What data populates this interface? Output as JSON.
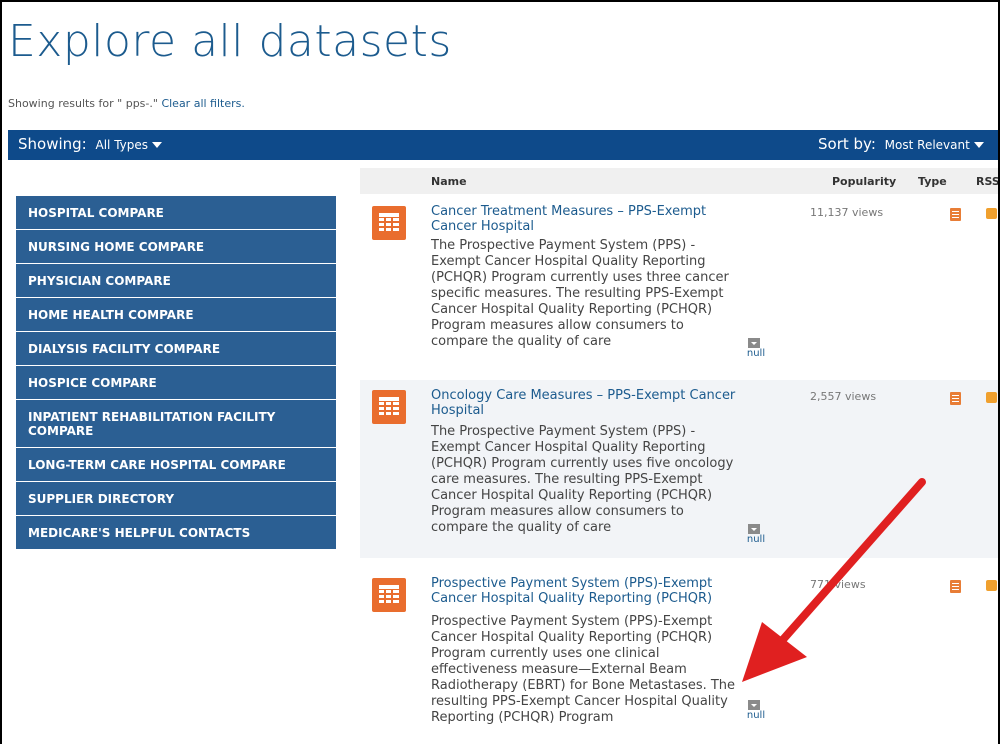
{
  "page": {
    "title": "Explore all datasets"
  },
  "filters": {
    "showing_prefix": "Showing results for \" pps-.\"",
    "clear_link": "Clear all filters."
  },
  "toolbar": {
    "showing_label": "Showing:",
    "showing_value": "All Types",
    "sort_label": "Sort by:",
    "sort_value": "Most Relevant"
  },
  "table": {
    "headers": {
      "name": "Name",
      "popularity": "Popularity",
      "type": "Type",
      "rss": "RSS"
    }
  },
  "sidebar": {
    "items": [
      {
        "label": "HOSPITAL COMPARE"
      },
      {
        "label": "NURSING HOME COMPARE"
      },
      {
        "label": "PHYSICIAN COMPARE"
      },
      {
        "label": "HOME HEALTH COMPARE"
      },
      {
        "label": "DIALYSIS FACILITY COMPARE"
      },
      {
        "label": "HOSPICE COMPARE"
      },
      {
        "label": "INPATIENT REHABILITATION FACILITY COMPARE"
      },
      {
        "label": "LONG-TERM CARE HOSPITAL COMPARE"
      },
      {
        "label": "SUPPLIER DIRECTORY"
      },
      {
        "label": "MEDICARE'S HELPFUL CONTACTS"
      }
    ]
  },
  "results": [
    {
      "title": "Cancer Treatment Measures – PPS-Exempt Cancer Hospital",
      "description": "The Prospective Payment System (PPS) -Exempt Cancer Hospital Quality Reporting (PCHQR) Program currently uses three cancer specific measures. The resulting PPS-Exempt Cancer Hospital Quality Reporting (PCHQR) Program measures allow consumers to compare the quality of care",
      "views": "11,137 views",
      "null_label": "null"
    },
    {
      "title": "Oncology Care Measures – PPS-Exempt Cancer Hospital",
      "description": "The Prospective Payment System (PPS) -Exempt Cancer Hospital Quality Reporting (PCHQR) Program currently uses five oncology care measures. The resulting PPS-Exempt Cancer Hospital Quality Reporting (PCHQR) Program measures allow consumers to compare the quality of care",
      "views": "2,557 views",
      "null_label": "null"
    },
    {
      "title": "Prospective Payment System (PPS)-Exempt Cancer Hospital Quality Reporting (PCHQR)",
      "description": "Prospective Payment System (PPS)-Exempt Cancer Hospital Quality Reporting (PCHQR) Program currently uses one clinical effectiveness measure—External Beam Radiotherapy (EBRT) for Bone Metastases. The resulting PPS-Exempt Cancer Hospital Quality Reporting (PCHQR) Program",
      "views": "771 views",
      "null_label": "null"
    }
  ],
  "colors": {
    "title_blue": "#1c5b8e",
    "topbar_blue": "#0e4a8a",
    "sidebar_blue": "#2b5f93",
    "dataset_icon_orange": "#e96d2e",
    "arrow_red": "#e02020"
  },
  "icons": {
    "dataset": "table-grid-icon",
    "type": "document-icon",
    "rss": "rss-icon",
    "null": "dropdown-icon"
  }
}
